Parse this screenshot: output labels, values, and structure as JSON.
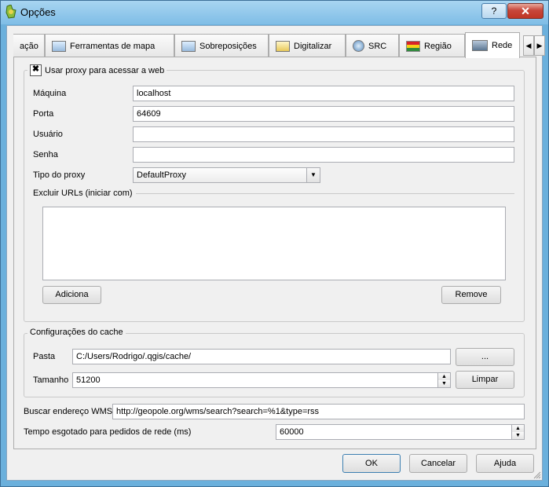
{
  "window": {
    "title": "Opções"
  },
  "titlebar": {
    "help_label": "?",
    "close_label": "✕"
  },
  "tabs": [
    {
      "label": "ação",
      "icon": "truncated-tab-icon",
      "active": false
    },
    {
      "label": "Ferramentas de mapa",
      "icon": "map-tools-icon",
      "active": false
    },
    {
      "label": "Sobreposições",
      "icon": "overlays-icon",
      "active": false
    },
    {
      "label": "Digitalizar",
      "icon": "digitize-icon",
      "active": false
    },
    {
      "label": "SRC",
      "icon": "globe-icon",
      "active": false
    },
    {
      "label": "Região",
      "icon": "flag-icon",
      "active": false
    },
    {
      "label": "Rede",
      "icon": "network-icon",
      "active": true
    }
  ],
  "tab_scroll": {
    "left": "◀",
    "right": "▶"
  },
  "proxy": {
    "enabled_mark": "✖",
    "group_title": "Usar proxy para acessar a web",
    "host_label": "Máquina",
    "host_value": "localhost",
    "port_label": "Porta",
    "port_value": "64609",
    "user_label": "Usuário",
    "user_value": "",
    "password_label": "Senha",
    "password_value": "",
    "type_label": "Tipo do proxy",
    "type_value": "DefaultProxy",
    "exclude_label": "Excluir URLs (iniciar com)",
    "add_button": "Adiciona",
    "remove_button": "Remove"
  },
  "cache": {
    "group_title": "Configurações do cache",
    "folder_label": "Pasta",
    "folder_value": "C:/Users/Rodrigo/.qgis/cache/",
    "browse_button": "...",
    "size_label": "Tamanho",
    "size_value": "51200",
    "clear_button": "Limpar"
  },
  "wms": {
    "label": "Buscar endereço WMS",
    "value": "http://geopole.org/wms/search?search=%1&type=rss"
  },
  "timeout": {
    "label": "Tempo esgotado para pedidos de rede (ms)",
    "value": "60000"
  },
  "spin_arrows": {
    "up": "▲",
    "down": "▼"
  },
  "combo_arrow": "▼",
  "buttons": {
    "ok": "OK",
    "cancel": "Cancelar",
    "help": "Ajuda"
  },
  "colors": {
    "titlebar": "#7fbde6",
    "close": "#c7473a",
    "dialog_bg": "#f0f0f0"
  }
}
